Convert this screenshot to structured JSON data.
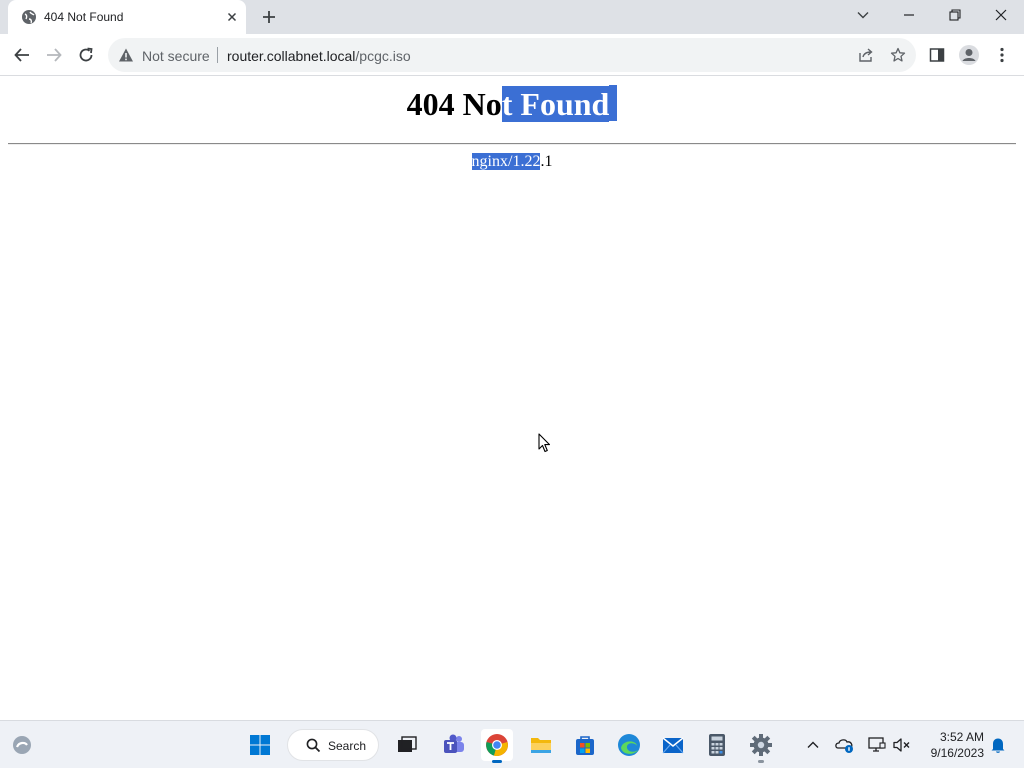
{
  "browser": {
    "tab": {
      "title": "404 Not Found",
      "favicon": "globe-icon"
    },
    "address_bar": {
      "security_label": "Not secure",
      "url_host": "router.collabnet.local",
      "url_path": "/pcgc.iso"
    }
  },
  "page": {
    "heading_plain": "404 No",
    "heading_selected": "t Found",
    "server_selected": "nginx/1.22",
    "server_plain": ".1"
  },
  "taskbar": {
    "search_label": "Search",
    "apps": [
      "task-view",
      "teams",
      "chrome",
      "file-explorer",
      "microsoft-store",
      "edge",
      "mail",
      "calculator",
      "settings"
    ],
    "clock": {
      "time": "3:52 AM",
      "date": "9/16/2023"
    }
  },
  "colors": {
    "selection": "#3b6fd4",
    "tabstrip": "#dee1e6",
    "omnibox": "#f1f3f4",
    "taskbar": "#eef1f6",
    "accent": "#0067c0"
  }
}
